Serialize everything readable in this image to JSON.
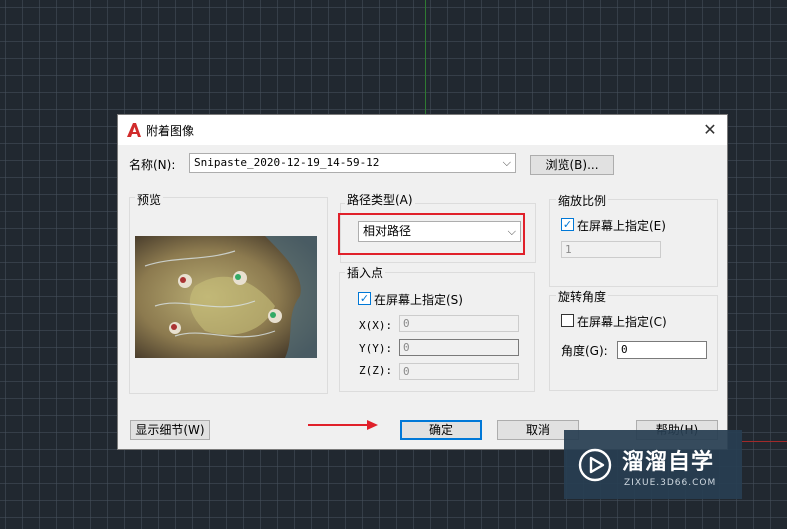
{
  "dialog": {
    "title": "附着图像",
    "close_glyph": "✕",
    "name_label": "名称(N):",
    "name_value": "Snipaste_2020-12-19_14-59-12",
    "browse_label": "浏览(B)...",
    "preview_label": "预览",
    "path_type": {
      "label": "路径类型(A)",
      "selected": "相对路径"
    },
    "insertion": {
      "label": "插入点",
      "specify_on_screen_label": "在屏幕上指定(S)",
      "specify_on_screen_checked": true,
      "x_label": "X(X):",
      "x_value": "0",
      "y_label": "Y(Y):",
      "y_value": "0",
      "z_label": "Z(Z):",
      "z_value": "0"
    },
    "scale": {
      "label": "缩放比例",
      "specify_on_screen_label": "在屏幕上指定(E)",
      "specify_on_screen_checked": true,
      "value": "1"
    },
    "rotation": {
      "label": "旋转角度",
      "specify_on_screen_label": "在屏幕上指定(C)",
      "specify_on_screen_checked": false,
      "angle_label": "角度(G):",
      "angle_value": "0"
    },
    "buttons": {
      "details": "显示细节(W)",
      "ok": "确定",
      "cancel": "取消",
      "help": "帮助(H)"
    }
  },
  "watermark": {
    "brand": "溜溜自学",
    "url": "ZIXUE.3D66.COM"
  },
  "colors": {
    "cad_background": "#212830",
    "highlight_box": "#e0202a",
    "focus_blue": "#0078d7"
  }
}
